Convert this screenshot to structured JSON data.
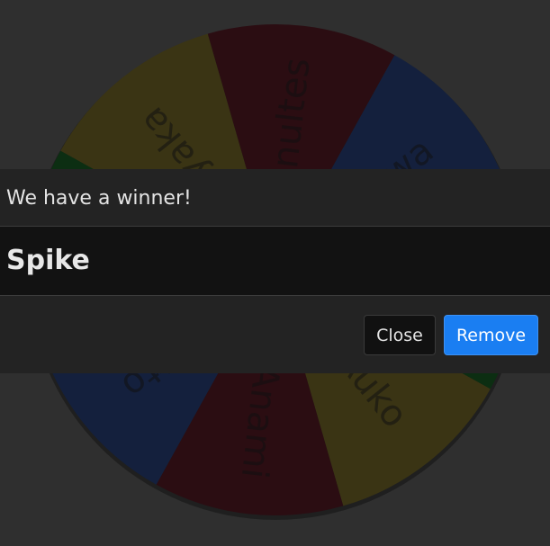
{
  "wheel": {
    "segments": [
      {
        "label": "Inultes",
        "color": "#2b0d12"
      },
      {
        "label": "Towa",
        "color": "#14203d"
      },
      {
        "label": "",
        "color": "#0c2e12"
      },
      {
        "label": "Auko",
        "color": "#3a3414"
      },
      {
        "label": "Anami",
        "color": "#2b0d12"
      },
      {
        "label": "Otto",
        "color": "#14203d"
      },
      {
        "label": "",
        "color": "#0c2e12"
      },
      {
        "label": "Tyaka",
        "color": "#3a3414"
      }
    ]
  },
  "modal": {
    "title": "We have a winner!",
    "winner": "Spike",
    "close_label": "Close",
    "remove_label": "Remove"
  },
  "colors": {
    "background": "#2f2f2f",
    "modal_bg": "#232323",
    "modal_body_bg": "#121212",
    "primary": "#1a7ef2"
  }
}
